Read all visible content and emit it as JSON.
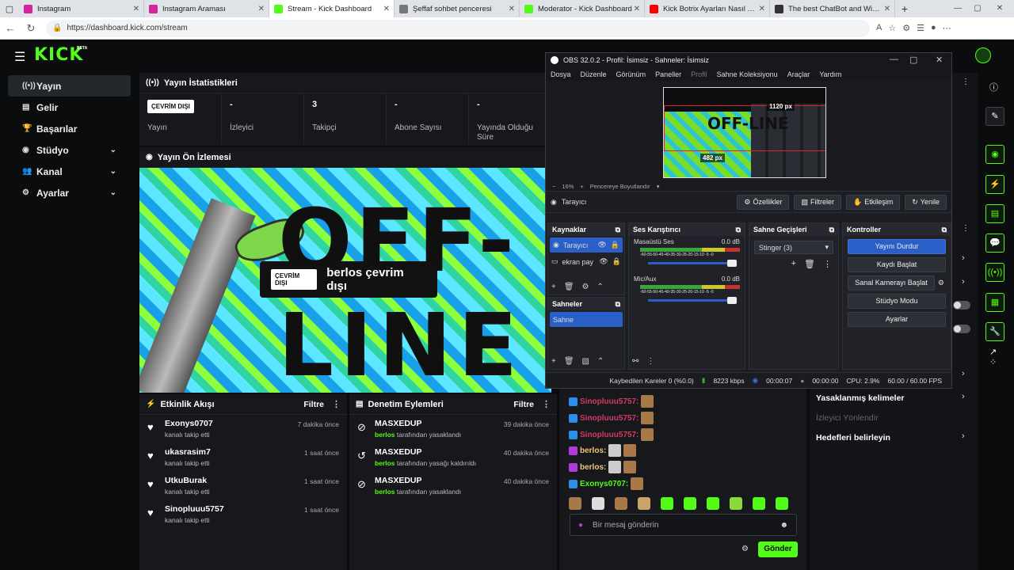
{
  "browser": {
    "tabs": [
      {
        "label": "Instagram",
        "color": "#d6249f"
      },
      {
        "label": "Instagram Araması",
        "color": "#d6249f"
      },
      {
        "label": "Stream - Kick Dashboard",
        "color": "#53fc18",
        "active": true
      },
      {
        "label": "Şeffaf sohbet penceresi",
        "color": "#777777"
      },
      {
        "label": "Moderator - Kick Dashboard",
        "color": "#53fc18"
      },
      {
        "label": "Kick Botrix Ayarları Nasıl Yapılır?",
        "color": "#ff0000"
      },
      {
        "label": "The best ChatBot and Widgets fo",
        "color": "#333333"
      }
    ],
    "url": "https://dashboard.kick.com/stream"
  },
  "kick": {
    "logo": "KICK",
    "beta": "BETA",
    "accent": "#53fc18",
    "sidebar": [
      {
        "label": "Yayın",
        "icon": "broadcast-icon"
      },
      {
        "label": "Gelir",
        "icon": "revenue-icon"
      },
      {
        "label": "Başarılar",
        "icon": "trophy-icon"
      },
      {
        "label": "Stüdyo",
        "icon": "studio-icon"
      },
      {
        "label": "Kanal",
        "icon": "channel-icon"
      },
      {
        "label": "Ayarlar",
        "icon": "gear-icon"
      }
    ],
    "stats": {
      "title": "Yayın İstatistikleri",
      "offline_badge": "ÇEVRİM DIŞI",
      "items": [
        {
          "value": "",
          "label": "Yayın"
        },
        {
          "value": "-",
          "label": "İzleyici"
        },
        {
          "value": "3",
          "label": "Takipçi"
        },
        {
          "value": "-",
          "label": "Abone Sayısı"
        },
        {
          "value": "-",
          "label": "Yayında Olduğu Süre"
        }
      ]
    },
    "preview": {
      "title": "Yayın Ön İzlemesi",
      "big_line1": "OFF-",
      "big_line2": "LINE",
      "badge": "ÇEVRİM DIŞI",
      "text": "berlos çevrim dışı"
    },
    "activity": {
      "title": "Etkinlik Akışı",
      "filter": "Filtre",
      "items": [
        {
          "user": "Exonys0707",
          "action": "kanalı takip etti",
          "time": "7 dakika önce"
        },
        {
          "user": "ukasrasim7",
          "action": "kanalı takip etti",
          "time": "1 saat önce"
        },
        {
          "user": "UtkuBurak",
          "action": "kanalı takip etti",
          "time": "1 saat önce"
        },
        {
          "user": "Sinopluuu5757",
          "action": "kanalı takip etti",
          "time": "1 saat önce"
        }
      ]
    },
    "moderation": {
      "title": "Denetim Eylemleri",
      "filter": "Filtre",
      "items": [
        {
          "user": "MASXEDUP",
          "by": "berlos",
          "action": "tarafından yasaklandı",
          "time": "39 dakika önce"
        },
        {
          "user": "MASXEDUP",
          "by": "berlos",
          "action": "tarafından yasağı kaldırıldı",
          "time": "40 dakika önce"
        },
        {
          "user": "MASXEDUP",
          "by": "berlos",
          "action": "tarafından yasaklandı",
          "time": "40 dakika önce"
        }
      ]
    },
    "chat": {
      "lines": [
        {
          "user": "Sinopluuu5757:",
          "color": "#d43a62"
        },
        {
          "user": "Sinopluuu5757:",
          "color": "#d43a62"
        },
        {
          "user": "Sinopluuu5757:",
          "color": "#d43a62"
        },
        {
          "user": "berlos:",
          "color": "#f1c57c"
        },
        {
          "user": "berlos:",
          "color": "#f1c57c"
        },
        {
          "user": "Exonys0707:",
          "color": "#53fc18"
        }
      ],
      "placeholder": "Bir mesaj gönderin",
      "send": "Gönder"
    },
    "settings_links": [
      {
        "label": "Yasaklanmış kelimeler"
      },
      {
        "label": "İzleyici Yönlendir"
      },
      {
        "label": "Hedefleri belirleyin"
      }
    ]
  },
  "obs": {
    "title": "OBS 32.0.2 - Profil: İsimsiz - Sahneler: İsimsiz",
    "menu": [
      "Dosya",
      "Düzenle",
      "Görünüm",
      "Paneller",
      "Profil",
      "Sahne Koleksiyonu",
      "Araçlar",
      "Yardım"
    ],
    "dim_w": "1120 px",
    "dim_h": "482 px",
    "offline_text": "OFF-LINE",
    "zoom": "16%",
    "zoom_mode": "Pencereye Boyutlandır",
    "selected_source": "Tarayıcı",
    "buttons": {
      "props": "Özellikler",
      "filters": "Filtreler",
      "interact": "Etkileşim",
      "refresh": "Yenile"
    },
    "sources_title": "Kaynaklar",
    "sources": [
      "Tarayıcı",
      "ekran pay"
    ],
    "scenes_title": "Sahneler",
    "scenes": [
      "Sahne"
    ],
    "mixer_title": "Ses Karıştırıcı",
    "mixer": [
      {
        "name": "Masaüstü Ses",
        "db": "0.0 dB"
      },
      {
        "name": "Mic/Aux",
        "db": "0.0 dB"
      }
    ],
    "meter_scale": "-60-55-50-45-40-35-30-25-20-15-10 -5 -0",
    "transitions_title": "Sahne Geçişleri",
    "transition": "Stinger (3)",
    "controls_title": "Kontroller",
    "controls": [
      "Yayını Durdur",
      "Kaydı Başlat",
      "Sanal Kamerayı Başlat",
      "Stüdyo Modu",
      "Ayarlar"
    ],
    "status": {
      "dropped": "Kaybedilen Kareler 0 (%0.0)",
      "kbps": "8223 kbps",
      "stream_time": "00:00:07",
      "rec_time": "00:00:00",
      "cpu": "CPU: 2.9%",
      "fps": "60.00 / 60.00 FPS"
    }
  }
}
